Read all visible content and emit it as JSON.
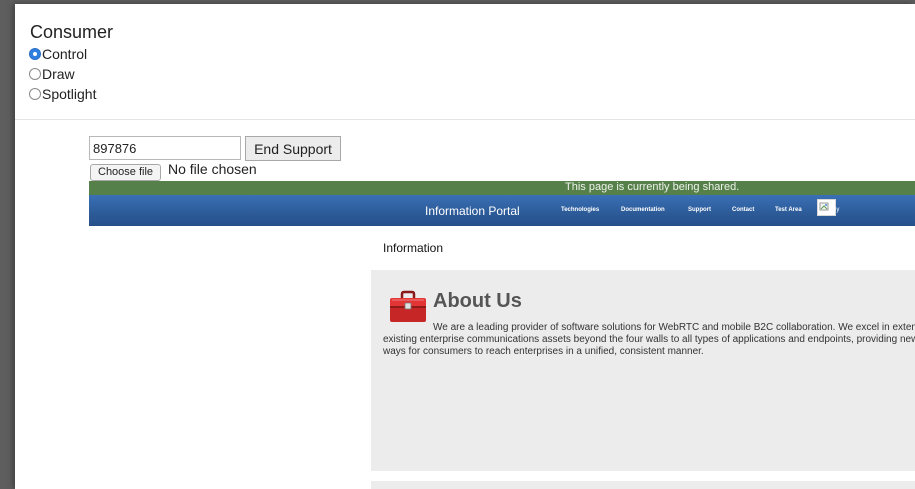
{
  "consumer": {
    "title": "Consumer",
    "modes": [
      {
        "label": "Control",
        "selected": true
      },
      {
        "label": "Draw",
        "selected": false
      },
      {
        "label": "Spotlight",
        "selected": false
      }
    ]
  },
  "support": {
    "session_code": "897876",
    "end_button_label": "End Support",
    "choose_file_label": "Choose file",
    "no_file_label": "No file chosen"
  },
  "shared_page": {
    "banner_text": "This page is currently being shared.",
    "portal_name": "Information Portal",
    "nav": [
      "Technologies",
      "Documentation",
      "Support",
      "Contact",
      "Test Area"
    ],
    "broken_image_alt": "ey",
    "section_heading": "Information",
    "about_title": "About Us",
    "about_text": "We are a leading provider of software solutions for WebRTC and mobile B2C collaboration. We excel in extending existing enterprise communications assets beyond the four walls to all types of applications and endpoints, providing new ways for consumers to reach enterprises in a unified, consistent manner."
  },
  "colors": {
    "radio_selected": "#2f7fe0",
    "banner_green": "#55804a",
    "nav_blue": "#2d5c9a",
    "content_gray": "#ececec",
    "toolbox_red": "#d32a2a"
  },
  "icons": {
    "about": "toolbox-icon",
    "broken_image": "broken-image-icon"
  }
}
